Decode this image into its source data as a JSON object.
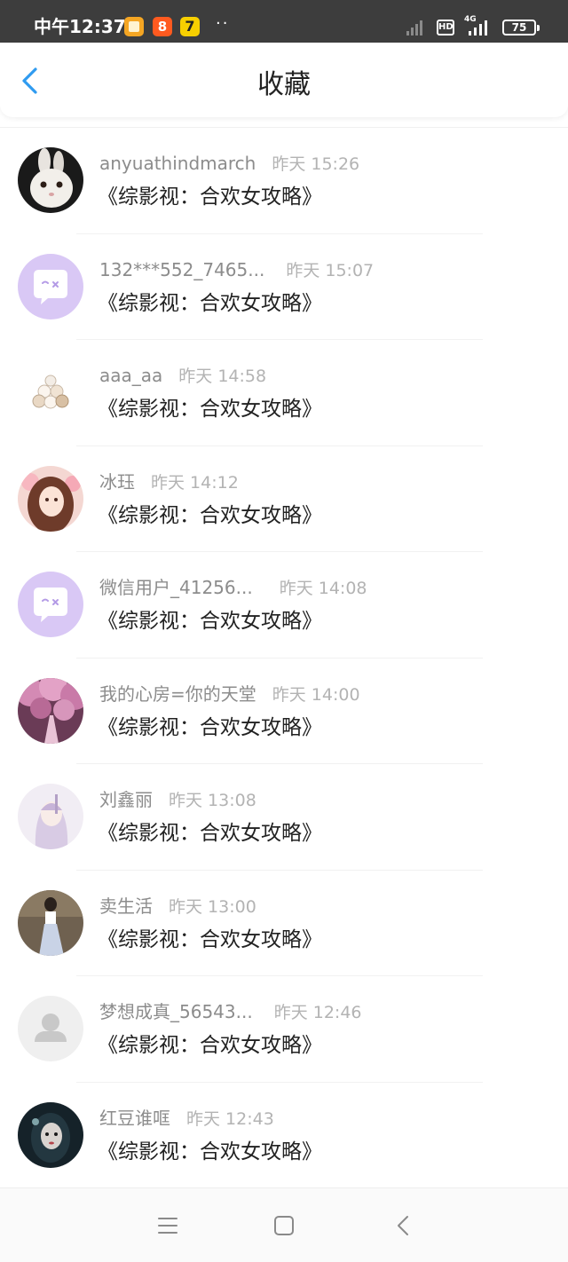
{
  "status_bar": {
    "time": "中午12:37",
    "dots": "··",
    "hd": "HD",
    "network": "4G",
    "battery": "75"
  },
  "header": {
    "title": "收藏"
  },
  "items": [
    {
      "user": "anyuathindmarch",
      "time": "昨天 15:26",
      "title": "《综影视：合欢女攻略》"
    },
    {
      "user": "132***552_7465...",
      "time": "昨天 15:07",
      "title": "《综影视：合欢女攻略》"
    },
    {
      "user": "aaa_aa",
      "time": "昨天 14:58",
      "title": "《综影视：合欢女攻略》"
    },
    {
      "user": "冰珏",
      "time": "昨天 14:12",
      "title": "《综影视：合欢女攻略》"
    },
    {
      "user": "微信用户_41256...",
      "time": "昨天 14:08",
      "title": "《综影视：合欢女攻略》"
    },
    {
      "user": "我的心房=你的天堂",
      "time": "昨天 14:00",
      "title": "《综影视：合欢女攻略》"
    },
    {
      "user": "刘鑫丽",
      "time": "昨天 13:08",
      "title": "《综影视：合欢女攻略》"
    },
    {
      "user": "卖生活",
      "time": "昨天 13:00",
      "title": "《综影视：合欢女攻略》"
    },
    {
      "user": "梦想成真_56543...",
      "time": "昨天 12:46",
      "title": "《综影视：合欢女攻略》"
    },
    {
      "user": "红豆谁哐",
      "time": "昨天 12:43",
      "title": "《综影视：合欢女攻略》"
    }
  ],
  "colors": {
    "accent": "#2f9bf0",
    "status_bar_bg": "#3d3d3d",
    "default_avatar_bg": "#d9c8f5"
  },
  "icons": {
    "back": "chevron-left-icon",
    "menu": "menu-icon",
    "home": "square-icon",
    "nav_back": "chevron-left-icon"
  }
}
